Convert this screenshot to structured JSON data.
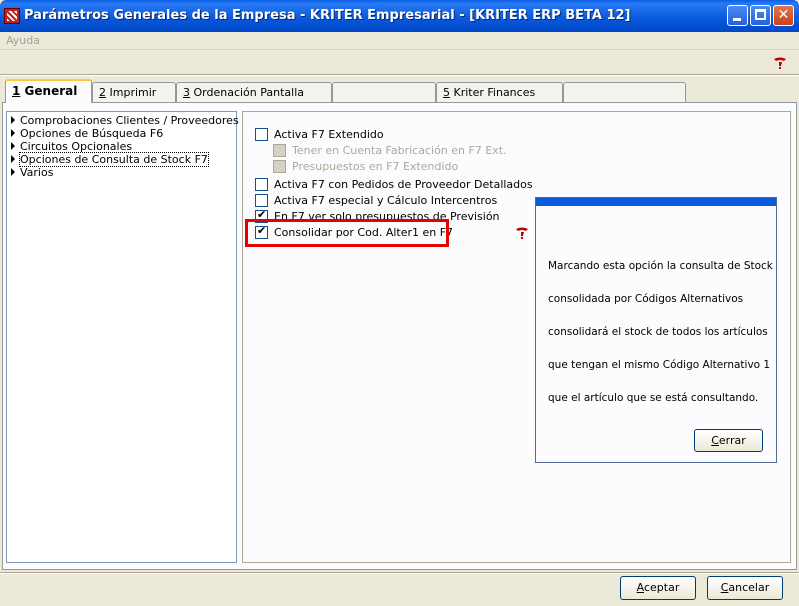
{
  "window": {
    "title": "Parámetros Generales de la Empresa - KRITER Empresarial - [KRITER ERP BETA 12]",
    "close_glyph": "✕"
  },
  "menu": {
    "items": [
      "Ayuda"
    ]
  },
  "tabs": [
    {
      "key": "1",
      "label": " General"
    },
    {
      "key": "2",
      "label": " Imprimir"
    },
    {
      "key": "3",
      "label": " Ordenación Pantalla"
    },
    {
      "key": "",
      "label": ""
    },
    {
      "key": "5",
      "label": " Kriter Finances"
    },
    {
      "key": "",
      "label": ""
    }
  ],
  "tree": {
    "items": [
      "Comprobaciones Clientes / Proveedores",
      "Opciones de Búsqueda F6",
      "Circuitos Opcionales",
      "Opciones de Consulta de Stock F7",
      "Varios"
    ],
    "selected_index": 3
  },
  "options": [
    {
      "label": "Activa F7 Extendido",
      "checked": false,
      "disabled": false
    },
    {
      "label": "Tener en Cuenta Fabricación en F7 Ext.",
      "checked": false,
      "disabled": true
    },
    {
      "label": "Presupuestos en F7 Extendido",
      "checked": false,
      "disabled": true
    },
    {
      "label": "Activa F7 con Pedidos de Proveedor Detallados",
      "checked": false,
      "disabled": false
    },
    {
      "label": "Activa F7 especial y Cálculo Intercentros",
      "checked": false,
      "disabled": false
    },
    {
      "label": "En F7 ver solo presupuestos de Previsión",
      "checked": true,
      "disabled": false
    },
    {
      "label": "Consolidar por Cod. Alter1 en F7",
      "checked": true,
      "disabled": false
    }
  ],
  "popup": {
    "lines": [
      "Marcando esta opción la consulta de Stock",
      "consolidada por Códigos Alternativos",
      "consolidará el stock de todos los artículos",
      "que tengan el mismo Código Alternativo 1",
      "que el artículo que se está consultando."
    ],
    "close_mnemonic": "C",
    "close_rest": "errar"
  },
  "buttons": {
    "accept_mnemonic": "A",
    "accept_rest": "ceptar",
    "cancel_mnemonic": "C",
    "cancel_rest": "ancelar"
  },
  "colors": {
    "titlebar": "#0a5bdc",
    "highlight": "#e60000",
    "check": "#21a121"
  }
}
